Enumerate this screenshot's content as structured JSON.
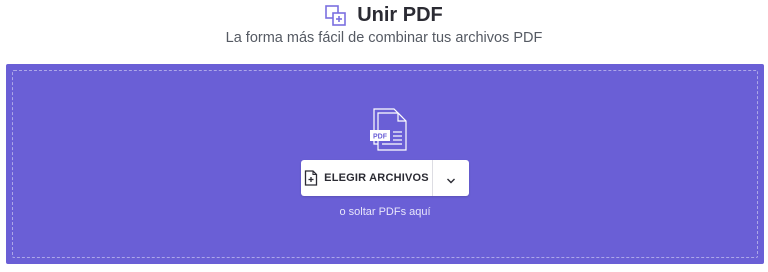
{
  "header": {
    "icon": "merge-pdf-icon",
    "title": "Unir PDF",
    "subtitle": "La forma más fácil de combinar tus archivos PDF"
  },
  "dropzone": {
    "graphic": "pdf-files-icon",
    "graphic_label": "PDF",
    "choose_button_label": "ELEGIR ARCHIVOS",
    "choose_button_icon": "add-document-icon",
    "dropdown_icon": "chevron-down-icon",
    "drop_hint": "o soltar PDFs aquí"
  },
  "colors": {
    "accent": "#6a5fd6",
    "title_icon": "#7b6fe0",
    "text_dark": "#2b2b33"
  }
}
